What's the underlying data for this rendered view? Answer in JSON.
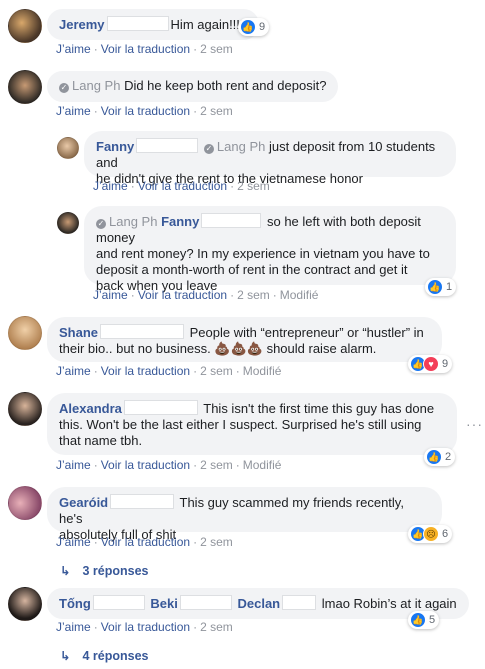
{
  "colors": {
    "link": "#385898",
    "muted": "#90949c",
    "bubble": "#f2f3f5",
    "like": "#1877f2",
    "love": "#f33e58",
    "sad": "#f7b125"
  },
  "common": {
    "like": "J’aime",
    "translate": "Voir la traduction",
    "sep": "·",
    "edited": "Modifié"
  },
  "comments": [
    {
      "author": "Jeremy",
      "text": "Him again!!!!!",
      "time": "2 sem",
      "reactions": {
        "icons": [
          "like-icon"
        ],
        "count": "9"
      }
    },
    {
      "tag": "Lang Ph",
      "text": "Did he keep both rent and deposit?",
      "time": "2 sem"
    },
    {
      "author": "Fanny",
      "tag": "Lang Ph",
      "text1": "just deposit from 10 students and",
      "text2": "he didn't give the rent to the vietnamese honor",
      "time": "2 sem"
    },
    {
      "tag": "Lang Ph",
      "author": "Fanny",
      "text1": "so he left with both deposit money",
      "text2": "and rent money? In my experience in vietnam you have to",
      "text3": "deposit a month-worth of rent in the contract and get it",
      "text4": "back when you leave",
      "time": "2 sem",
      "reactions": {
        "icons": [
          "like-icon"
        ],
        "count": "1"
      }
    },
    {
      "author": "Shane",
      "text1": "People with “entrepreneur” or “hustler” in",
      "text2": "their bio.. but no business.",
      "emoji": "💩💩💩",
      "text3": "should raise alarm.",
      "time": "2 sem",
      "reactions": {
        "icons": [
          "like-icon",
          "love-icon"
        ],
        "count": "9"
      }
    },
    {
      "author": "Alexandra",
      "text1": "This isn't the first time this guy has done",
      "text2": "this. Won't be the last either I suspect. Surprised he's still using",
      "text3": "that name tbh.",
      "time": "2 sem",
      "reactions": {
        "icons": [
          "like-icon"
        ],
        "count": "2"
      }
    },
    {
      "author": "Gearóid",
      "text1": "This guy scammed my friends recently, he's",
      "text2": "absolutely full of shit",
      "time": "2 sem",
      "reactions": {
        "icons": [
          "like-icon",
          "sad-icon"
        ],
        "count": "6"
      },
      "replies": "3 réponses"
    },
    {
      "author": "Tống",
      "tag1": "Beki",
      "tag2": "Declan",
      "text": "lmao Robin’s at it again",
      "time": "2 sem",
      "reactions": {
        "icons": [
          "like-icon"
        ],
        "count": "5"
      },
      "replies": "4 réponses"
    }
  ]
}
